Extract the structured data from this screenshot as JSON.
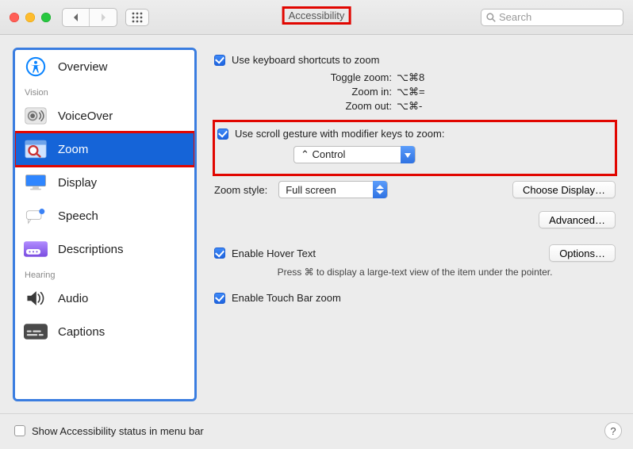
{
  "header": {
    "title": "Accessibility",
    "search_placeholder": "Search"
  },
  "sidebar": {
    "sections": [
      {
        "label": "",
        "items": [
          {
            "icon": "accessibility-icon",
            "label": "Overview"
          }
        ]
      },
      {
        "label": "Vision",
        "items": [
          {
            "icon": "voiceover-icon",
            "label": "VoiceOver"
          },
          {
            "icon": "zoom-icon",
            "label": "Zoom",
            "selected": true
          },
          {
            "icon": "display-icon",
            "label": "Display"
          },
          {
            "icon": "speech-icon",
            "label": "Speech"
          },
          {
            "icon": "descriptions-icon",
            "label": "Descriptions"
          }
        ]
      },
      {
        "label": "Hearing",
        "items": [
          {
            "icon": "audio-icon",
            "label": "Audio"
          },
          {
            "icon": "captions-icon",
            "label": "Captions"
          }
        ]
      }
    ]
  },
  "pane": {
    "use_kb_shortcuts": {
      "checked": true,
      "label": "Use keyboard shortcuts to zoom"
    },
    "shortcuts": [
      {
        "name": "Toggle zoom:",
        "keys": "⌥⌘8"
      },
      {
        "name": "Zoom in:",
        "keys": "⌥⌘="
      },
      {
        "name": "Zoom out:",
        "keys": "⌥⌘-"
      }
    ],
    "use_scroll_gesture": {
      "checked": true,
      "label": "Use scroll gesture with modifier keys to zoom:"
    },
    "modifier_select": {
      "value": "⌃ Control"
    },
    "zoom_style_label": "Zoom style:",
    "zoom_style_value": "Full screen",
    "choose_display_btn": "Choose Display…",
    "advanced_btn": "Advanced…",
    "enable_hover": {
      "checked": true,
      "label": "Enable Hover Text"
    },
    "options_btn": "Options…",
    "hover_hint": "Press ⌘ to display a large-text view of the item under the pointer.",
    "enable_touchbar": {
      "checked": true,
      "label": "Enable Touch Bar zoom"
    }
  },
  "footer": {
    "show_status": {
      "checked": false,
      "label": "Show Accessibility status in menu bar"
    },
    "help": "?"
  }
}
